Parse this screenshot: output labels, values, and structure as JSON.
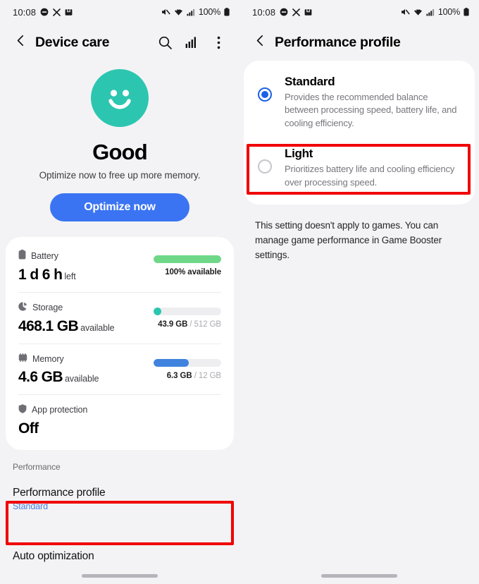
{
  "colors": {
    "accent_blue": "#3b74f2",
    "radio_blue": "#1a62e8",
    "link_blue": "#4a7fe0",
    "teal": "#2cc6b0",
    "green": "#6ed888",
    "memory_blue": "#3f83de",
    "highlight_red": "#f00000",
    "page_bg": "#f3f3f5",
    "card_bg": "#ffffff"
  },
  "status_bar": {
    "time": "10:08",
    "battery_percent": "100%",
    "left_icons": [
      "dnd-icon",
      "mute-x-icon",
      "saved-image-icon"
    ],
    "right_icons": [
      "sound-muted-icon",
      "wifi-icon",
      "signal-icon",
      "battery-icon"
    ]
  },
  "left_screen": {
    "appbar": {
      "back_icon": "chevron-left-icon",
      "title": "Device care",
      "actions": [
        "search-icon",
        "chart-icon",
        "more-options-icon"
      ]
    },
    "hero": {
      "face_icon": "smiley-face-icon",
      "status": "Good",
      "subtitle": "Optimize now to free up more memory.",
      "button_label": "Optimize now"
    },
    "status_rows": [
      {
        "icon": "battery-icon",
        "label": "Battery",
        "value": "1 d 6 h",
        "unit": "left",
        "bar_label_used": "100% available",
        "bar_label_total": "",
        "bar_percent": 100,
        "bar_color": "#6ed888"
      },
      {
        "icon": "storage-icon",
        "label": "Storage",
        "value": "468.1 GB",
        "unit": "available",
        "bar_label_used": "43.9 GB",
        "bar_label_total": "/ 512 GB",
        "bar_percent": 8.5,
        "bar_color": "#2cc6b0"
      },
      {
        "icon": "memory-icon",
        "label": "Memory",
        "value": "4.6 GB",
        "unit": "available",
        "bar_label_used": "6.3 GB",
        "bar_label_total": "/ 12 GB",
        "bar_percent": 52,
        "bar_color": "#3f83de"
      },
      {
        "icon": "shield-icon",
        "label": "App protection",
        "value": "Off",
        "unit": "",
        "bar_label_used": "",
        "bar_label_total": "",
        "bar_percent": 0,
        "bar_color": ""
      }
    ],
    "performance_section": {
      "header": "Performance",
      "items": [
        {
          "title": "Performance profile",
          "subtitle": "Standard"
        },
        {
          "title": "Auto optimization",
          "subtitle": ""
        }
      ]
    }
  },
  "right_screen": {
    "appbar": {
      "back_icon": "chevron-left-icon",
      "title": "Performance profile"
    },
    "options": [
      {
        "title": "Standard",
        "description": "Provides the recommended balance between processing speed, battery life, and cooling efficiency.",
        "selected": true
      },
      {
        "title": "Light",
        "description": "Prioritizes battery life and cooling efficiency over processing speed.",
        "selected": false
      }
    ],
    "footnote": "This setting doesn't apply to games. You can manage game performance in Game Booster settings."
  }
}
